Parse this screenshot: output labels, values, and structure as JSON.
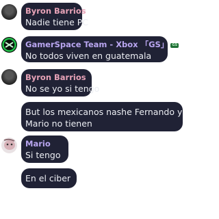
{
  "messages": [
    {
      "sender": "Byron Barrios",
      "text": "Nadie tiene PC"
    },
    {
      "sender": "GamerSpace Team - Xbox 「GS」",
      "badge": "GS",
      "text": "No todos viven en guatemala"
    },
    {
      "sender": "Byron Barrios",
      "text": "No se yo si tengo"
    },
    {
      "text_line1": "But los mexicanos nashe Fernando y",
      "text_line2": "Mario no tienen"
    },
    {
      "sender": "Mario",
      "text": "Si tengo"
    },
    {
      "text": "En el ciber"
    }
  ],
  "colors": {
    "bubble_bg": "#202235",
    "name_pink": "#e8a3b8",
    "name_purple": "#b9a6f0",
    "message_text": "#eceef3"
  }
}
